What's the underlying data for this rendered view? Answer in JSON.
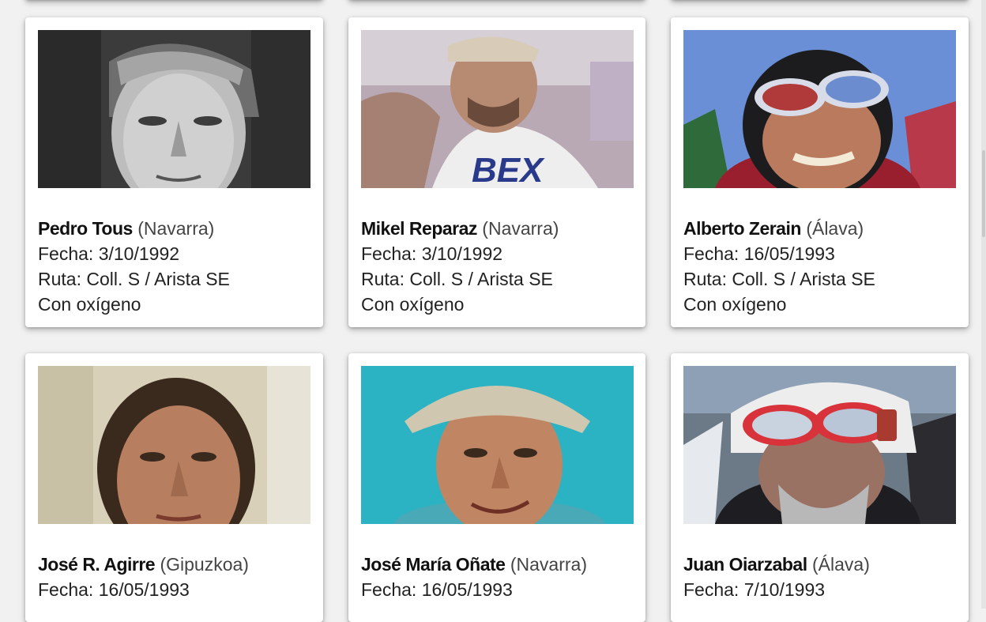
{
  "climbers": [
    {
      "name": "Pedro Tous",
      "province": "(Navarra)",
      "date": "Fecha: 3/10/1992",
      "route": "Ruta: Coll. S / Arista SE",
      "oxygen": "Con oxígeno",
      "photo": "climber-photo-bw-portrait"
    },
    {
      "name": "Mikel Reparaz",
      "province": "(Navarra)",
      "date": "Fecha: 3/10/1992",
      "route": "Ruta: Coll. S / Arista SE",
      "oxygen": "Con oxígeno",
      "photo": "climber-photo-cap-tshirt"
    },
    {
      "name": "Alberto Zerain",
      "province": "(Álava)",
      "date": "Fecha: 16/05/1993",
      "route": "Ruta: Coll. S / Arista SE",
      "oxygen": "Con oxígeno",
      "photo": "climber-photo-goggles-beanie"
    },
    {
      "name": "José R. Agirre",
      "province": "(Gipuzkoa)",
      "date": "Fecha: 16/05/1993",
      "route": "",
      "oxygen": "",
      "photo": "climber-photo-portrait"
    },
    {
      "name": "José María Oñate",
      "province": "(Navarra)",
      "date": "Fecha: 16/05/1993",
      "route": "",
      "oxygen": "",
      "photo": "climber-photo-cap-teal-bg"
    },
    {
      "name": "Juan Oiarzabal",
      "province": "(Álava)",
      "date": "Fecha: 7/10/1993",
      "route": "",
      "oxygen": "",
      "photo": "climber-photo-red-goggles-helmet"
    }
  ],
  "colors": {
    "page_bg": "#f1f1f1",
    "card_bg": "#ffffff",
    "text": "#222222"
  }
}
